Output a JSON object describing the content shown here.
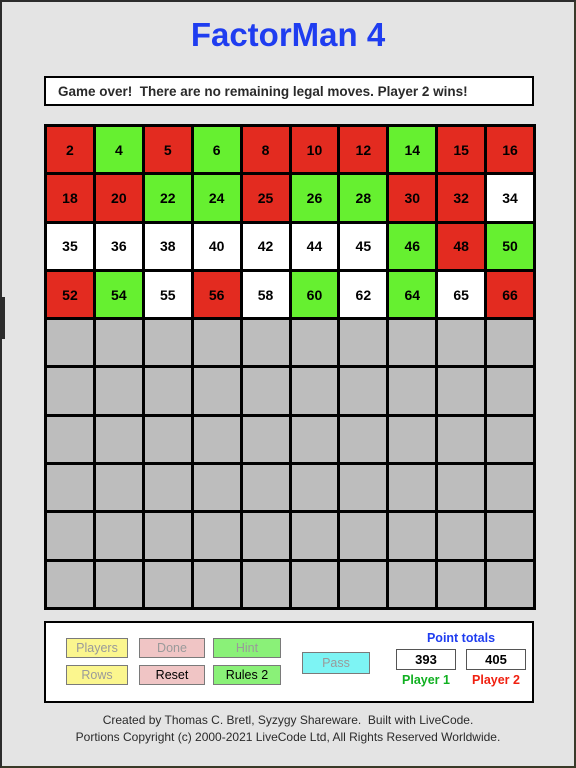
{
  "app": {
    "title": "FactorMan 4",
    "title_color": "#1f3df0"
  },
  "status": {
    "message": "Game over!  There are no remaining legal moves. Player 2 wins!"
  },
  "board": {
    "columns": 10,
    "rows": 10,
    "legend": {
      "red": "#e32b20",
      "green": "#66f030",
      "white": "#ffffff",
      "empty": "#bdbdbd"
    },
    "cells": [
      {
        "value": "2",
        "state": "red"
      },
      {
        "value": "4",
        "state": "green"
      },
      {
        "value": "5",
        "state": "red"
      },
      {
        "value": "6",
        "state": "green"
      },
      {
        "value": "8",
        "state": "red"
      },
      {
        "value": "10",
        "state": "red"
      },
      {
        "value": "12",
        "state": "red"
      },
      {
        "value": "14",
        "state": "green"
      },
      {
        "value": "15",
        "state": "red"
      },
      {
        "value": "16",
        "state": "red"
      },
      {
        "value": "18",
        "state": "red"
      },
      {
        "value": "20",
        "state": "red"
      },
      {
        "value": "22",
        "state": "green"
      },
      {
        "value": "24",
        "state": "green"
      },
      {
        "value": "25",
        "state": "red"
      },
      {
        "value": "26",
        "state": "green"
      },
      {
        "value": "28",
        "state": "green"
      },
      {
        "value": "30",
        "state": "red"
      },
      {
        "value": "32",
        "state": "red"
      },
      {
        "value": "34",
        "state": "white"
      },
      {
        "value": "35",
        "state": "white"
      },
      {
        "value": "36",
        "state": "white"
      },
      {
        "value": "38",
        "state": "white"
      },
      {
        "value": "40",
        "state": "white"
      },
      {
        "value": "42",
        "state": "white"
      },
      {
        "value": "44",
        "state": "white"
      },
      {
        "value": "45",
        "state": "white"
      },
      {
        "value": "46",
        "state": "green"
      },
      {
        "value": "48",
        "state": "red"
      },
      {
        "value": "50",
        "state": "green"
      },
      {
        "value": "52",
        "state": "red"
      },
      {
        "value": "54",
        "state": "green"
      },
      {
        "value": "55",
        "state": "white"
      },
      {
        "value": "56",
        "state": "red"
      },
      {
        "value": "58",
        "state": "white"
      },
      {
        "value": "60",
        "state": "green"
      },
      {
        "value": "62",
        "state": "white"
      },
      {
        "value": "64",
        "state": "green"
      },
      {
        "value": "65",
        "state": "white"
      },
      {
        "value": "66",
        "state": "red"
      },
      {
        "value": "",
        "state": "empty"
      },
      {
        "value": "",
        "state": "empty"
      },
      {
        "value": "",
        "state": "empty"
      },
      {
        "value": "",
        "state": "empty"
      },
      {
        "value": "",
        "state": "empty"
      },
      {
        "value": "",
        "state": "empty"
      },
      {
        "value": "",
        "state": "empty"
      },
      {
        "value": "",
        "state": "empty"
      },
      {
        "value": "",
        "state": "empty"
      },
      {
        "value": "",
        "state": "empty"
      },
      {
        "value": "",
        "state": "empty"
      },
      {
        "value": "",
        "state": "empty"
      },
      {
        "value": "",
        "state": "empty"
      },
      {
        "value": "",
        "state": "empty"
      },
      {
        "value": "",
        "state": "empty"
      },
      {
        "value": "",
        "state": "empty"
      },
      {
        "value": "",
        "state": "empty"
      },
      {
        "value": "",
        "state": "empty"
      },
      {
        "value": "",
        "state": "empty"
      },
      {
        "value": "",
        "state": "empty"
      },
      {
        "value": "",
        "state": "empty"
      },
      {
        "value": "",
        "state": "empty"
      },
      {
        "value": "",
        "state": "empty"
      },
      {
        "value": "",
        "state": "empty"
      },
      {
        "value": "",
        "state": "empty"
      },
      {
        "value": "",
        "state": "empty"
      },
      {
        "value": "",
        "state": "empty"
      },
      {
        "value": "",
        "state": "empty"
      },
      {
        "value": "",
        "state": "empty"
      },
      {
        "value": "",
        "state": "empty"
      },
      {
        "value": "",
        "state": "empty"
      },
      {
        "value": "",
        "state": "empty"
      },
      {
        "value": "",
        "state": "empty"
      },
      {
        "value": "",
        "state": "empty"
      },
      {
        "value": "",
        "state": "empty"
      },
      {
        "value": "",
        "state": "empty"
      },
      {
        "value": "",
        "state": "empty"
      },
      {
        "value": "",
        "state": "empty"
      },
      {
        "value": "",
        "state": "empty"
      },
      {
        "value": "",
        "state": "empty"
      },
      {
        "value": "",
        "state": "empty"
      },
      {
        "value": "",
        "state": "empty"
      },
      {
        "value": "",
        "state": "empty"
      },
      {
        "value": "",
        "state": "empty"
      },
      {
        "value": "",
        "state": "empty"
      },
      {
        "value": "",
        "state": "empty"
      },
      {
        "value": "",
        "state": "empty"
      },
      {
        "value": "",
        "state": "empty"
      },
      {
        "value": "",
        "state": "empty"
      },
      {
        "value": "",
        "state": "empty"
      },
      {
        "value": "",
        "state": "empty"
      },
      {
        "value": "",
        "state": "empty"
      },
      {
        "value": "",
        "state": "empty"
      },
      {
        "value": "",
        "state": "empty"
      },
      {
        "value": "",
        "state": "empty"
      },
      {
        "value": "",
        "state": "empty"
      },
      {
        "value": "",
        "state": "empty"
      },
      {
        "value": "",
        "state": "empty"
      },
      {
        "value": "",
        "state": "empty"
      },
      {
        "value": "",
        "state": "empty"
      }
    ]
  },
  "controls": {
    "players": {
      "label": "Players",
      "enabled": false
    },
    "rows": {
      "label": "Rows",
      "enabled": false
    },
    "done": {
      "label": "Done",
      "enabled": false
    },
    "reset": {
      "label": "Reset",
      "enabled": true
    },
    "hint": {
      "label": "Hint",
      "enabled": false
    },
    "rules": {
      "label": "Rules 2",
      "enabled": true
    },
    "pass": {
      "label": "Pass",
      "enabled": false
    }
  },
  "scores": {
    "heading": "Point totals",
    "player1": {
      "label": "Player 1",
      "value": "393",
      "color": "#10b020"
    },
    "player2": {
      "label": "Player 2",
      "value": "405",
      "color": "#f02010"
    }
  },
  "footer": {
    "line1": "Created by Thomas C. Bretl, Syzygy Shareware.  Built with LiveCode.",
    "line2": "Portions Copyright (c) 2000-2021 LiveCode Ltd, All Rights Reserved Worldwide."
  }
}
